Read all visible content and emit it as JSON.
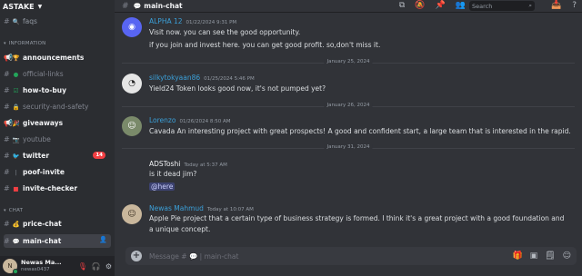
{
  "server": {
    "name": "ASTAKE"
  },
  "sidebar": {
    "top_channel": {
      "icon": "magnifier-icon",
      "label": "faqs"
    },
    "category_information": "INFORMATION",
    "info_channels": [
      {
        "label": "announcements",
        "emoji": "trophy-icon",
        "style": "bright"
      },
      {
        "label": "official-links",
        "emoji": "green-circle-icon",
        "style": "muted"
      },
      {
        "label": "how-to-buy",
        "emoji": "check-box-icon",
        "style": "bright"
      },
      {
        "label": "security-and-safety",
        "emoji": "lock-icon",
        "style": "muted"
      },
      {
        "label": "giveaways",
        "emoji": "party-icon",
        "style": "bright"
      },
      {
        "label": "youtube",
        "emoji": "camera-icon",
        "style": "muted"
      },
      {
        "label": "twitter",
        "emoji": "bird-icon",
        "style": "bright",
        "badge": "14"
      },
      {
        "label": "poof-invite",
        "emoji": "",
        "style": "bright"
      },
      {
        "label": "invite-checker",
        "emoji": "stop-icon",
        "style": "bright"
      }
    ],
    "category_chat": "CHAT",
    "chat_channels": [
      {
        "label": "price-chat",
        "emoji": "money-bag-icon",
        "style": "bright"
      },
      {
        "label": "main-chat",
        "emoji": "speech-icon",
        "style": "active"
      }
    ]
  },
  "user": {
    "display_name": "Newas Ma...",
    "tag": "newas0437"
  },
  "header": {
    "channel_name": "main-chat",
    "search_placeholder": "Search"
  },
  "messages": [
    {
      "author": "ALPHA 12",
      "author_color": "#3ba0d9",
      "time": "01/22/2024 9:31 PM",
      "avatar_icon": "discord-logo-icon",
      "avatar_bg": "#5865f2",
      "lines": [
        "Visit now. you can see the good opportunity.",
        "if you join and invest here. you can get good profit. so,don't miss it."
      ]
    },
    {
      "divider": "January 25, 2024"
    },
    {
      "author": "silkytokyaan86",
      "author_color": "#3ba0d9",
      "time": "01/25/2024 5:46 PM",
      "avatar_icon": "glasses-avatar-icon",
      "avatar_bg": "#e6e6e6",
      "lines": [
        "Yield24 Token  looks good now, it's not pumped yet?"
      ]
    },
    {
      "divider": "January 26, 2024"
    },
    {
      "author": "Lorenzo",
      "author_color": "#3ba0d9",
      "time": "01/26/2024 8:50 AM",
      "avatar_icon": "person-avatar-icon",
      "avatar_bg": "#7a8a6a",
      "lines": [
        "Cavada An interesting project with great prospects! A good and confident start, a large team that is interested in the rapid."
      ]
    },
    {
      "divider": "January 31, 2024"
    },
    {
      "author": "ADSToshi",
      "author_color": "#f2f3f5",
      "time": "Today at 5:37 AM",
      "avatar_icon": "",
      "avatar_bg": "#313338",
      "lines": [
        "is it dead jim?"
      ],
      "mention": "@here"
    },
    {
      "author": "Newas Mahmud",
      "author_color": "#3ba0d9",
      "time": "Today at 10:07 AM",
      "avatar_icon": "person-avatar-icon",
      "avatar_bg": "#c9b79c",
      "lines": [
        "Apple Pie project that a certain type of business strategy is formed. I think it's a great project with a good foundation and",
        "a unique concept."
      ]
    }
  ],
  "composer": {
    "placeholder": "Message #",
    "channel": "| main-chat"
  }
}
